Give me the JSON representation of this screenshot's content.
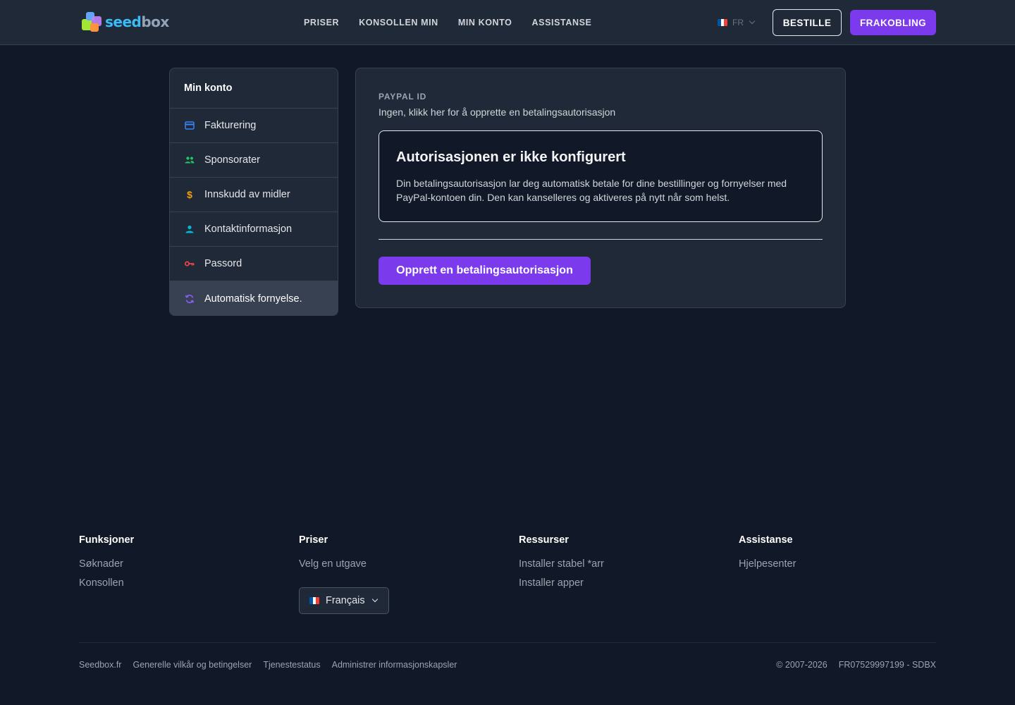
{
  "header": {
    "logo": {
      "part1": "seed",
      "part2": "box"
    },
    "nav": [
      "PRISER",
      "KONSOLLEN MIN",
      "MIN KONTO",
      "ASSISTANSE"
    ],
    "language": {
      "code": "FR",
      "flag_colors": [
        "#0055A4",
        "#FFFFFF",
        "#EF4135"
      ]
    },
    "order_label": "BESTILLE",
    "logout_label": "FRAKOBLING"
  },
  "sidebar": {
    "title": "Min konto",
    "items": [
      {
        "label": "Fakturering",
        "icon": "credit-card-icon",
        "color": "#3b82f6"
      },
      {
        "label": "Sponsorater",
        "icon": "users-icon",
        "color": "#22c55e"
      },
      {
        "label": "Innskudd av midler",
        "icon": "dollar-icon",
        "color": "#f59e0b"
      },
      {
        "label": "Kontaktinformasjon",
        "icon": "user-icon",
        "color": "#06b6d4"
      },
      {
        "label": "Passord",
        "icon": "key-icon",
        "color": "#ef4444"
      },
      {
        "label": "Automatisk fornyelse.",
        "icon": "refresh-icon",
        "color": "#8b5cf6",
        "active": true
      }
    ]
  },
  "main": {
    "paypal_label": "PAYPAL ID",
    "paypal_value": "Ingen, klikk her for å opprette en betalingsautorisasjon",
    "notice_title": "Autorisasjonen er ikke konfigurert",
    "notice_text": "Din betalingsautorisasjon lar deg automatisk betale for dine bestillinger og fornyelser med PayPal-kontoen din. Den kan kanselleres og aktiveres på nytt når som helst.",
    "create_button": "Opprett en betalingsautorisasjon"
  },
  "footer": {
    "columns": [
      {
        "title": "Funksjoner",
        "links": [
          "Søknader",
          "Konsollen"
        ]
      },
      {
        "title": "Priser",
        "links": [
          "Velg en utgave"
        ]
      },
      {
        "title": "Ressurser",
        "links": [
          "Installer stabel *arr",
          "Installer apper"
        ]
      },
      {
        "title": "Assistanse",
        "links": [
          "Hjelpesenter"
        ]
      }
    ],
    "language_select": "Français",
    "bottom_links": [
      "Seedbox.fr",
      "Generelle vilkår og betingelser",
      "Tjenestestatus",
      "Administrer informasjonskapsler"
    ],
    "copyright": "© 2007-2026",
    "company_id": "FR07529997199 - SDBX"
  },
  "colors": {
    "accent": "#7c3aed",
    "background": "#111827",
    "surface": "#1f2937"
  }
}
